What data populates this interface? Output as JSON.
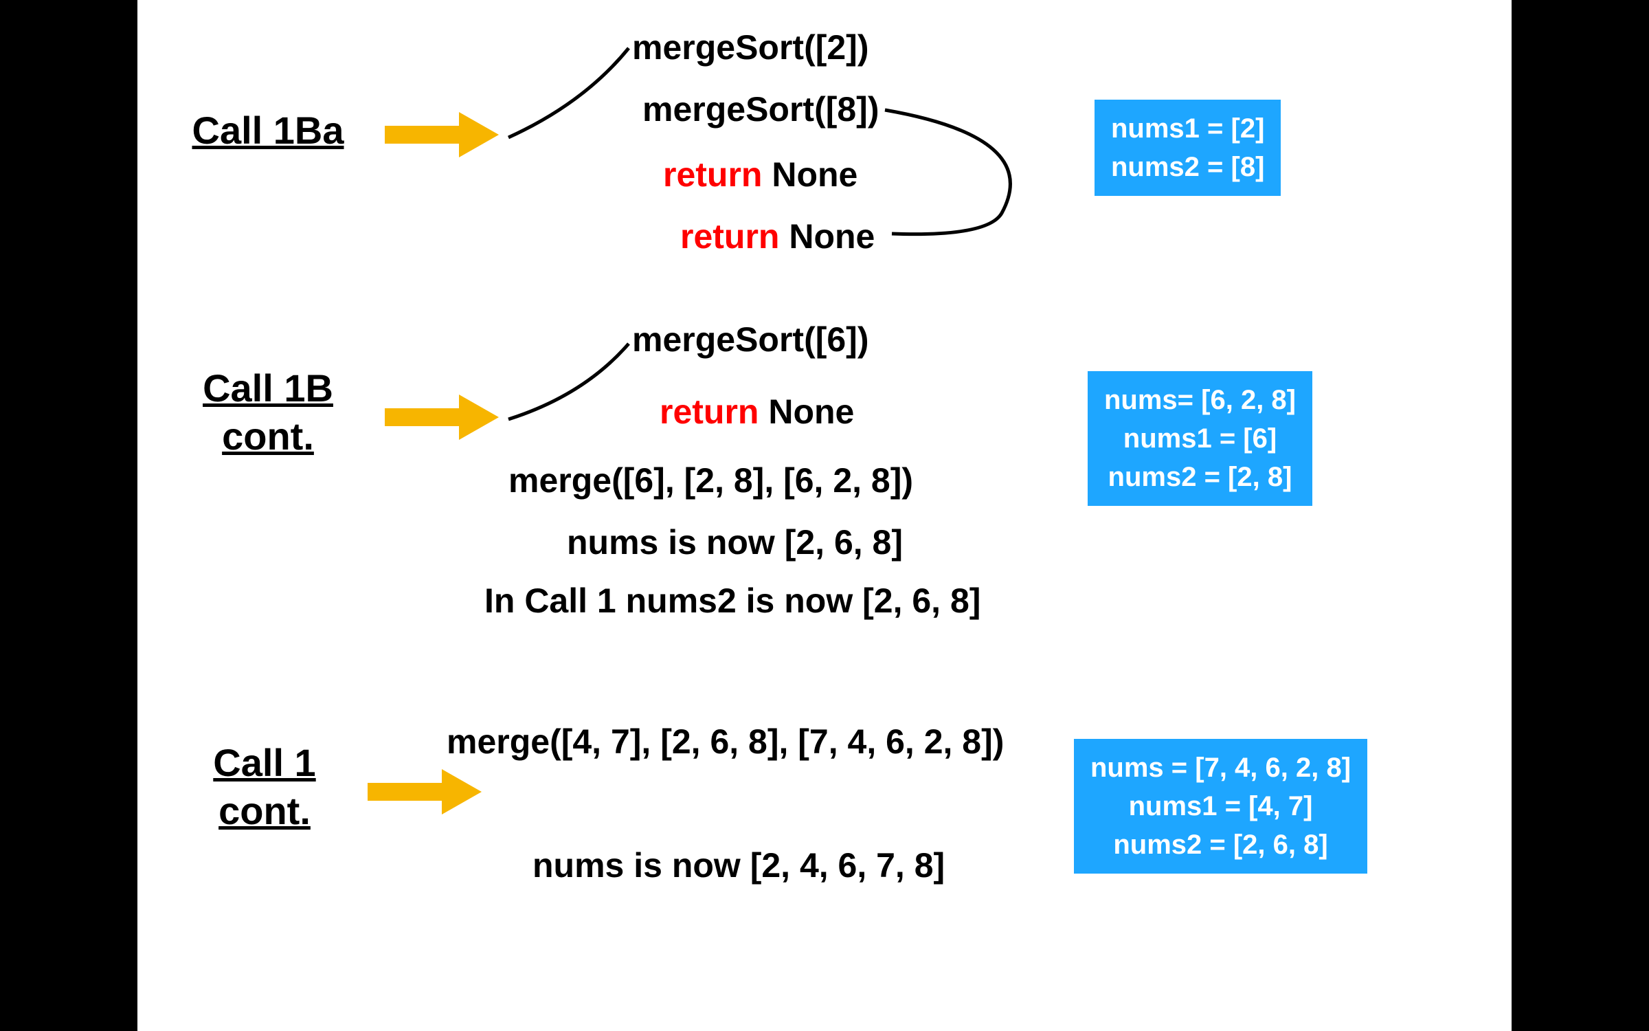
{
  "section1": {
    "label": "Call 1Ba",
    "line1": "mergeSort([2])",
    "line2": "mergeSort([8])",
    "ret3_kw": "return",
    "ret3_rest": " None",
    "ret4_kw": "return",
    "ret4_rest": " None",
    "box_l1": "nums1 = [2]",
    "box_l2": "nums2 = [8]"
  },
  "section2": {
    "label": "Call 1B\ncont.",
    "line1": "mergeSort([6])",
    "ret2_kw": "return",
    "ret2_rest": " None",
    "line3": "merge([6], [2, 8], [6, 2, 8])",
    "line4": "nums is now [2, 6, 8]",
    "line5": "In Call 1 nums2 is now [2, 6, 8]",
    "box_l1": "nums= [6, 2, 8]",
    "box_l2": "nums1 = [6]",
    "box_l3": "nums2 = [2, 8]"
  },
  "section3": {
    "label": "Call 1\ncont.",
    "line1": "merge([4, 7], [2, 6, 8], [7, 4, 6, 2, 8])",
    "line2": "nums is now [2, 4, 6, 7, 8]",
    "box_l1": "nums = [7, 4, 6, 2, 8]",
    "box_l2": "nums1 = [4, 7]",
    "box_l3": "nums2 = [2, 6, 8]"
  }
}
